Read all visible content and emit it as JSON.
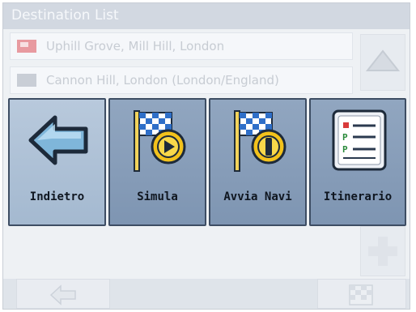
{
  "header": {
    "title": "Destination List"
  },
  "destinations": [
    {
      "label": "Uphill Grove, Mill Hill, London",
      "flag_color": "#e89aa0"
    },
    {
      "label": "Cannon Hill, London (London/England)",
      "flag_color": "#c9ced6"
    }
  ],
  "scroll": {
    "up_icon": "arrow-up-icon",
    "add_icon": "plus-icon"
  },
  "menu": {
    "back_label": "Indietro",
    "simulate_label": "Simula",
    "start_nav_label": "Avvia Navi",
    "itinerary_label": "Itinerario"
  },
  "colors": {
    "menu_button": "#7f96b3",
    "menu_border": "#3d4d63",
    "back_arrow": "#7fb6da",
    "flag_check": "#2f6fc8",
    "play_circle": "#f3c21b"
  }
}
